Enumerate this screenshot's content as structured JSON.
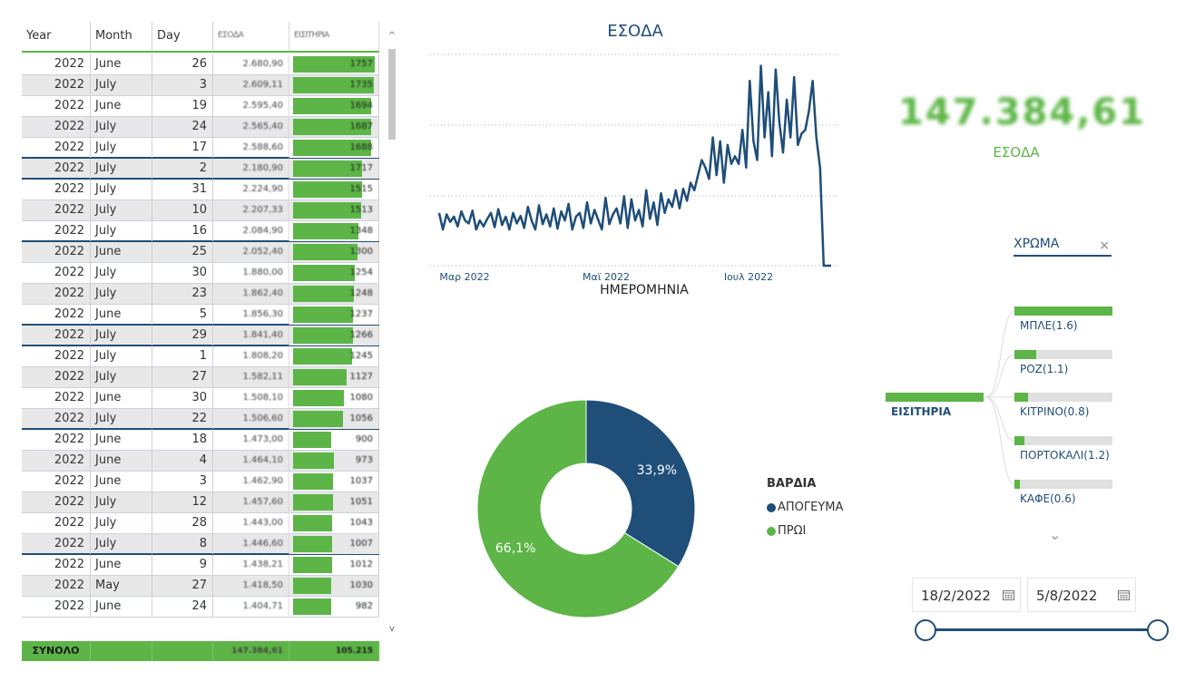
{
  "colors": {
    "green": "#5cb546",
    "navy": "#1f4e79",
    "alt_row": "#e8e8e8"
  },
  "table": {
    "headers": {
      "year": "Year",
      "month": "Month",
      "day": "Day",
      "amount": "ΕΣΟΔΑ",
      "tickets": "ΕΙΣΙΤΗΡΙΑ"
    },
    "rows": [
      {
        "year": "2022",
        "month": "June",
        "day": "26",
        "amount": "2.680,90",
        "tickets": "1757",
        "bar": 1.0
      },
      {
        "year": "2022",
        "month": "July",
        "day": "3",
        "amount": "2.609,11",
        "tickets": "1735",
        "bar": 0.99
      },
      {
        "year": "2022",
        "month": "June",
        "day": "19",
        "amount": "2.595,40",
        "tickets": "1694",
        "bar": 0.96
      },
      {
        "year": "2022",
        "month": "July",
        "day": "24",
        "amount": "2.565,40",
        "tickets": "1687",
        "bar": 0.96
      },
      {
        "year": "2022",
        "month": "July",
        "day": "17",
        "amount": "2.588,60",
        "tickets": "1688",
        "bar": 0.96
      },
      {
        "year": "2022",
        "month": "July",
        "day": "2",
        "amount": "2.180,90",
        "tickets": "1717",
        "bar": 0.84
      },
      {
        "year": "2022",
        "month": "July",
        "day": "31",
        "amount": "2.224,90",
        "tickets": "1515",
        "bar": 0.84
      },
      {
        "year": "2022",
        "month": "July",
        "day": "10",
        "amount": "2.207,33",
        "tickets": "1513",
        "bar": 0.83
      },
      {
        "year": "2022",
        "month": "July",
        "day": "16",
        "amount": "2.084,90",
        "tickets": "1348",
        "bar": 0.8
      },
      {
        "year": "2022",
        "month": "June",
        "day": "25",
        "amount": "2.052,40",
        "tickets": "1300",
        "bar": 0.79
      },
      {
        "year": "2022",
        "month": "July",
        "day": "30",
        "amount": "1.880,00",
        "tickets": "1254",
        "bar": 0.75
      },
      {
        "year": "2022",
        "month": "July",
        "day": "23",
        "amount": "1.862,40",
        "tickets": "1248",
        "bar": 0.74
      },
      {
        "year": "2022",
        "month": "June",
        "day": "5",
        "amount": "1.856,30",
        "tickets": "1237",
        "bar": 0.73
      },
      {
        "year": "2022",
        "month": "July",
        "day": "29",
        "amount": "1.841,40",
        "tickets": "1266",
        "bar": 0.73
      },
      {
        "year": "2022",
        "month": "July",
        "day": "1",
        "amount": "1.808,20",
        "tickets": "1245",
        "bar": 0.72
      },
      {
        "year": "2022",
        "month": "July",
        "day": "27",
        "amount": "1.582,11",
        "tickets": "1127",
        "bar": 0.65
      },
      {
        "year": "2022",
        "month": "June",
        "day": "30",
        "amount": "1.508,10",
        "tickets": "1080",
        "bar": 0.62
      },
      {
        "year": "2022",
        "month": "July",
        "day": "22",
        "amount": "1.506,60",
        "tickets": "1056",
        "bar": 0.61
      },
      {
        "year": "2022",
        "month": "June",
        "day": "18",
        "amount": "1.473,00",
        "tickets": "900",
        "bar": 0.47
      },
      {
        "year": "2022",
        "month": "June",
        "day": "4",
        "amount": "1.464,10",
        "tickets": "973",
        "bar": 0.5
      },
      {
        "year": "2022",
        "month": "June",
        "day": "3",
        "amount": "1.462,90",
        "tickets": "1037",
        "bar": 0.49
      },
      {
        "year": "2022",
        "month": "July",
        "day": "12",
        "amount": "1.457,60",
        "tickets": "1051",
        "bar": 0.49
      },
      {
        "year": "2022",
        "month": "July",
        "day": "28",
        "amount": "1.443,00",
        "tickets": "1043",
        "bar": 0.48
      },
      {
        "year": "2022",
        "month": "July",
        "day": "8",
        "amount": "1.446,60",
        "tickets": "1007",
        "bar": 0.48
      },
      {
        "year": "2022",
        "month": "June",
        "day": "9",
        "amount": "1.438,21",
        "tickets": "1012",
        "bar": 0.48
      },
      {
        "year": "2022",
        "month": "May",
        "day": "27",
        "amount": "1.418,50",
        "tickets": "1030",
        "bar": 0.47
      },
      {
        "year": "2022",
        "month": "June",
        "day": "24",
        "amount": "1.404,71",
        "tickets": "982",
        "bar": 0.47
      }
    ],
    "total": {
      "label": "ΣΥΝΟΛΟ",
      "amount": "147.384,61",
      "tickets": "105.215"
    }
  },
  "line_chart": {
    "title": "ΕΣΟΔΑ",
    "xlabel": "ΗΜΕΡΟΜΗΝΙΑ",
    "ticks": [
      "Μαρ 2022",
      "Μαϊ 2022",
      "Ιουλ 2022"
    ]
  },
  "chart_data": {
    "type": "line",
    "title": "ΕΣΟΔΑ",
    "xlabel": "ΗΜΕΡΟΜΗΝΙΑ",
    "ylabel": "",
    "x_start": "2022-02-18",
    "x_ticks": [
      "Μαρ 2022",
      "Μαϊ 2022",
      "Ιουλ 2022"
    ],
    "ylim": [
      0,
      2800
    ],
    "grid": true,
    "series": [
      {
        "values": [
          700,
          480,
          680,
          580,
          650,
          520,
          720,
          600,
          560,
          730,
          480,
          600,
          520,
          620,
          700,
          510,
          750,
          540,
          650,
          480,
          700,
          560,
          660,
          500,
          780,
          600,
          480,
          800,
          550,
          680,
          520,
          760,
          490,
          720,
          600,
          820,
          480,
          650,
          700,
          500,
          840,
          560,
          740,
          610,
          480,
          900,
          550,
          680,
          760,
          560,
          920,
          500,
          880,
          600,
          740,
          520,
          1000,
          620,
          840,
          540,
          960,
          700,
          880,
          780,
          1000,
          760,
          1020,
          860,
          1100,
          1000,
          1200,
          1400,
          1300,
          1150,
          1700,
          1200,
          1650,
          1100,
          1600,
          1350,
          1450,
          1350,
          1800,
          1300,
          2450,
          1650,
          1400,
          2650,
          1700,
          2300,
          1450,
          2600,
          1900,
          1500,
          2200,
          1700,
          2500,
          1600,
          1750,
          1800,
          2050,
          2450,
          1700,
          1300,
          0,
          0,
          0
        ]
      }
    ]
  },
  "kpi": {
    "value": "147.384,61",
    "label": "ΕΣΟΔΑ"
  },
  "donut": {
    "legend_title": "ΒΑΡΔΙΑ",
    "slices": [
      {
        "name": "ΑΠΟΓΕΥΜΑ",
        "value": 33.9,
        "label": "33,9%",
        "color": "#1f4e79"
      },
      {
        "name": "ΠΡΩΙ",
        "value": 66.1,
        "label": "66,1%",
        "color": "#5cb546"
      }
    ]
  },
  "tree": {
    "header": "ΧΡΩΜΑ",
    "close_icon": "×",
    "root": "ΕΙΣΙΤΗΡΙΑ",
    "children": [
      {
        "label": "ΜΠΛΕ(1.6)",
        "fill": 1.0
      },
      {
        "label": "ΡΟΖ(1.1)",
        "fill": 0.22
      },
      {
        "label": "ΚΙΤΡΙΝΟ(0.8)",
        "fill": 0.14
      },
      {
        "label": "ΠΟΡΤΟΚΑΛΙ(1.2)",
        "fill": 0.1
      },
      {
        "label": "ΚΑΦΕ(0.6)",
        "fill": 0.06
      }
    ],
    "more_icon": "⌄"
  },
  "date_slicer": {
    "start": "18/2/2022",
    "end": "5/8/2022"
  }
}
